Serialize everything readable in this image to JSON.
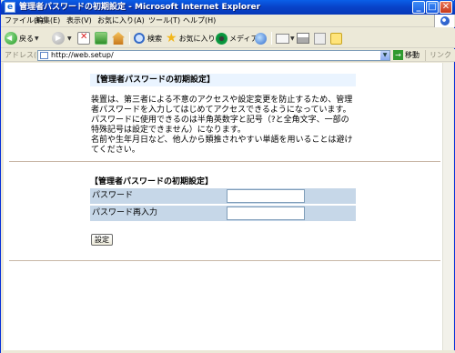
{
  "window": {
    "title": "管理者パスワードの初期設定 - Microsoft Internet Explorer",
    "app_icon": "ie-icon",
    "controls": {
      "minimize": "_",
      "maximize": "□",
      "close": "✕"
    }
  },
  "menu": {
    "items": [
      "ファイル(F)",
      "編集(E)",
      "表示(V)",
      "お気に入り(A)",
      "ツール(T)",
      "ヘルプ(H)"
    ]
  },
  "toolbar": {
    "back_label": "戻る",
    "search_label": "検索",
    "favorites_label": "お気に入り",
    "media_label": "メディア"
  },
  "address": {
    "label": "アドレス(D)",
    "url": "http://web.setup/",
    "go_label": "移動",
    "links_label": "リンク"
  },
  "page": {
    "heading": "【管理者パスワードの初期設定】",
    "description": [
      "装置は、第三者による不意のアクセスや設定変更を防止するため、管理者パスワードを入力してはじめてアクセスできるようになっています。",
      "パスワードに使用できるのは半角英数字と記号（?と全角文字、一部の特殊記号は設定できません）になります。",
      "名前や生年月日など、他人から類推されやすい単語を用いることは避けてください。"
    ],
    "form_heading": "【管理者パスワードの初期設定】",
    "password_label": "パスワード",
    "password_value": "",
    "password_confirm_label": "パスワード再入力",
    "password_confirm_value": "",
    "submit_label": "設定"
  },
  "colors": {
    "titlebar": "#0842c8",
    "heading_bg": "#eaf4ff",
    "form_row_bg": "#c6d7e8",
    "divider": "#c8b6a6"
  }
}
